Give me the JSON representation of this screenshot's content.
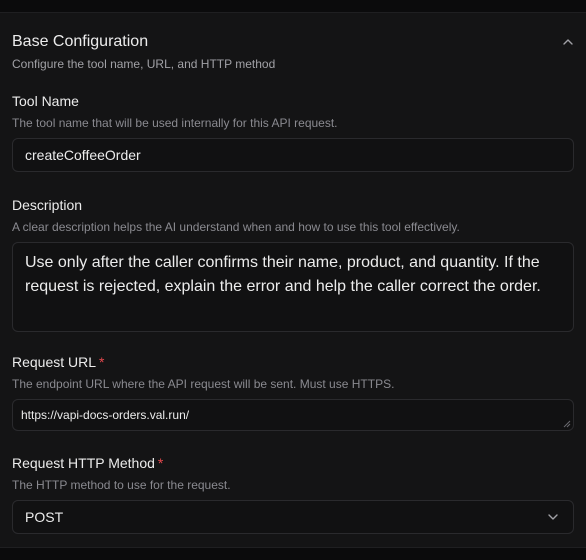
{
  "section": {
    "title": "Base Configuration",
    "subtitle": "Configure the tool name, URL, and HTTP method"
  },
  "tool_name": {
    "label": "Tool Name",
    "hint": "The tool name that will be used internally for this API request.",
    "value": "createCoffeeOrder"
  },
  "description": {
    "label": "Description",
    "hint": "A clear description helps the AI understand when and how to use this tool effectively.",
    "value": "Use only after the caller confirms their name, product, and quantity. If the request is rejected, explain the error and help the caller correct the order."
  },
  "request_url": {
    "label": "Request URL",
    "required_mark": "*",
    "hint": "The endpoint URL where the API request will be sent. Must use HTTPS.",
    "value": "https://vapi-docs-orders.val.run/"
  },
  "http_method": {
    "label": "Request HTTP Method",
    "required_mark": "*",
    "hint": "The HTTP method to use for the request.",
    "selected": "POST"
  },
  "icons": {
    "collapse": "chevron-up-icon",
    "dropdown": "chevron-down-icon"
  },
  "colors": {
    "background": "#141415",
    "required": "#e5484d",
    "text": "#ececec",
    "muted": "#8a8a90"
  }
}
